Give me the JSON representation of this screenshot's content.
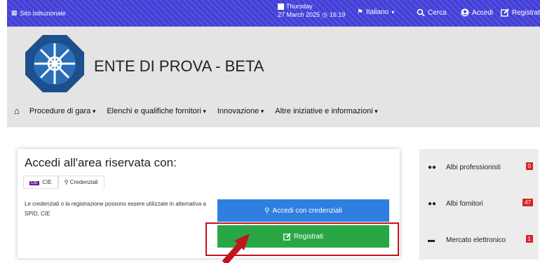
{
  "topbar": {
    "site_label": "Sito istituzionale",
    "day": "Thursday",
    "date": "27 March 2025",
    "time": "16:19",
    "language": "Italiano",
    "search": "Cerca",
    "login": "Accedi",
    "register": "Registrati"
  },
  "header": {
    "title": "ENTE DI PROVA - BETA",
    "nav": [
      {
        "label": "Procedure di gara"
      },
      {
        "label": "Elenchi e qualifiche fornitori"
      },
      {
        "label": "Innovazione"
      },
      {
        "label": "Altre iniziative e informazioni"
      }
    ]
  },
  "login_card": {
    "title": "Accedi all'area riservata con:",
    "tabs": [
      {
        "badge": "CIE",
        "label": "CIE"
      },
      {
        "label": "Credenziali"
      }
    ],
    "description": "Le credenziali o la registrazione possono essere utilizzate in alternativa a SPID, CIE",
    "login_button": "Accedi con credenziali",
    "register_button": "Registrati"
  },
  "sidebar": [
    {
      "label": "Albi professionisti",
      "badge": "0"
    },
    {
      "label": "Albi fornitori",
      "badge": "47"
    },
    {
      "label": "Mercato elettronico",
      "badge": "1"
    }
  ],
  "colors": {
    "topbar": "#4340d8",
    "primary_button": "#2e7fe0",
    "success_button": "#29a745",
    "highlight": "#c0141e",
    "badge": "#d9232d"
  }
}
